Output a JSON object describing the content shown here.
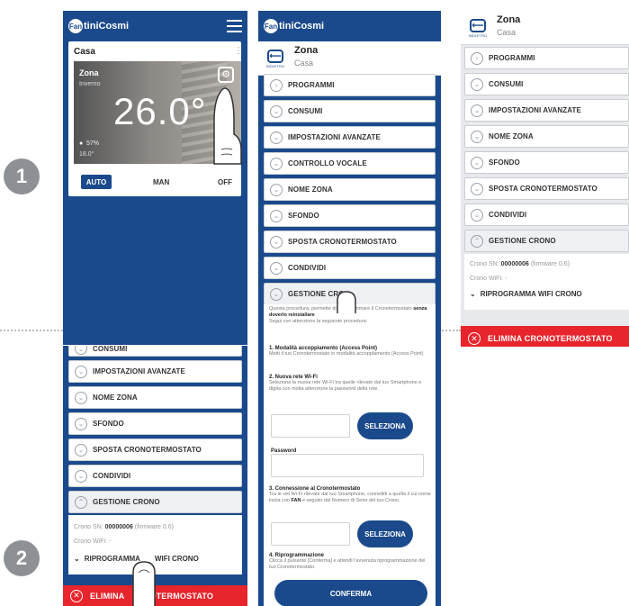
{
  "steps": {
    "one": "1",
    "two": "2"
  },
  "brand": {
    "logo_mark": "Fan",
    "logo_text": "tiniCosmi",
    "primary": "#1a4a8c",
    "danger": "#e8242c"
  },
  "home": {
    "house": "Casa",
    "zone": "Zona",
    "season": "Inverno",
    "temperature": "26.0°",
    "humidity": "57%",
    "setpoint": "18.0°",
    "modes": {
      "auto": "AUTO",
      "man": "MAN",
      "off": "OFF"
    }
  },
  "zone_header": {
    "title": "Zona",
    "subtitle": "Casa",
    "back_caption": "INDIETRO"
  },
  "menu": {
    "programmi": "PROGRAMMI",
    "consumi": "CONSUMI",
    "impostazioni": "IMPOSTAZIONI AVANZATE",
    "vocale": "CONTROLLO VOCALE",
    "nome": "NOME ZONA",
    "sfondo": "SFONDO",
    "sposta": "SPOSTA CRONOTERMOSTATO",
    "condividi": "CONDIVIDI",
    "gestione": "GESTIONE CRONO",
    "gestione_short": "GESTIONE CRO"
  },
  "crono": {
    "sn_label": "Crono SN:",
    "sn_value": "00000006",
    "firmware": "(firmware 0.6)",
    "wifi_label": "Crono WiFi: -",
    "reprogram": "RIPROGRAMMA WIFI CRONO",
    "delete": "ELIMINA CRONOTERMOSTATO",
    "delete_partial_a": "ELIMINA",
    "delete_partial_b": "OTERMOSTATO",
    "reprogram_partial_a": "RIPROGRAMMA",
    "reprogram_partial_b": "WIFI CRONO"
  },
  "reprogram_form": {
    "intro_a": "Questa procedura, permette di riprogrammare il",
    "intro_b": "Cronotermostato",
    "intro_bold": "senza doverlo reinstallare",
    "intro_c": "Segui con attenzione la seguente procedura:",
    "s1_title": "1. Modalità accoppiamento (Access Point)",
    "s1_text": "Metti il tuo Cronotermostato in modalità accoppiamento (Access Point)",
    "s2_title": "2. Nuova rete Wi-Fi",
    "s2_text": "Seleziona la nuova rete Wi-Fi tra quelle rilevate dal tuo Smartphone e digita con molta attenzione la password della rete.",
    "select_btn": "SELEZIONA",
    "password_label": "Password",
    "s3_title": "3. Connessione al Cronotermostato",
    "s3_text_a": "Tra le reti Wi-Fi rilevate dal tuo Smartphone, connettiti a quella il cui nome inizia con",
    "s3_bold": "FAN",
    "s3_text_b": "e seguito dal Numero di Serie del tuo Crono.",
    "select_btn2": "SELEZIONA",
    "s4_title": "4. Riprogrammazione",
    "s4_text": "Clicca il pulsante [Conferma] e attendi l'avvenuta riprogrammazione del tuo Cronotermostato.",
    "confirm": "CONFERMA"
  }
}
